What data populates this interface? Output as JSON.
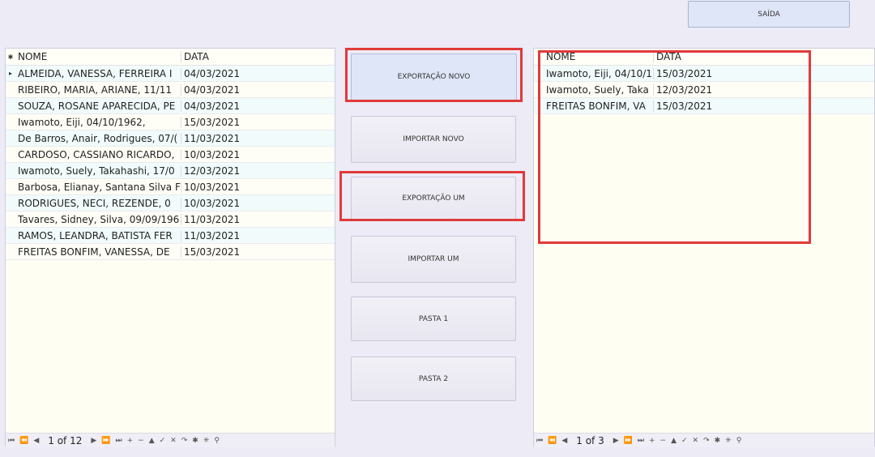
{
  "exit_button": "SAÍDA",
  "actions": {
    "export_new": "EXPORTAÇÃO NOVO",
    "import_new": "IMPORTAR NOVO",
    "export_one": "EXPORTAÇÃO UM",
    "import_one": "IMPORTAR UM",
    "folder1": "PASTA 1",
    "folder2": "PASTA 2"
  },
  "left_grid": {
    "header_indicator": "✱",
    "columns": [
      "NOME",
      "DATA"
    ],
    "rows": [
      [
        "ALMEIDA, VANESSA, FERREIRA I",
        "04/03/2021"
      ],
      [
        "RIBEIRO, MARIA, ARIANE, 11/11",
        "04/03/2021"
      ],
      [
        "SOUZA, ROSANE APARECIDA, PE",
        "04/03/2021"
      ],
      [
        "Iwamoto, Eiji, 04/10/1962,",
        "15/03/2021"
      ],
      [
        "De Barros, Anair, Rodrigues, 07/(",
        "11/03/2021"
      ],
      [
        "CARDOSO, CASSIANO RICARDO,",
        "10/03/2021"
      ],
      [
        "Iwamoto, Suely, Takahashi, 17/0",
        "12/03/2021"
      ],
      [
        "Barbosa, Elianay, Santana Silva F",
        "10/03/2021"
      ],
      [
        "RODRIGUES, NECI, REZENDE, 0",
        "10/03/2021"
      ],
      [
        "Tavares, Sidney, Silva, 09/09/196",
        "11/03/2021"
      ],
      [
        "RAMOS, LEANDRA, BATISTA FER",
        "11/03/2021"
      ],
      [
        "FREITAS BONFIM, VANESSA, DE",
        "15/03/2021"
      ]
    ],
    "current_row_indicator": "▸",
    "position": "1 of 12"
  },
  "right_grid": {
    "columns": [
      "NOME",
      "DATA"
    ],
    "rows": [
      [
        "Iwamoto, Eiji, 04/10/1",
        "15/03/2021"
      ],
      [
        "Iwamoto, Suely, Taka",
        "12/03/2021"
      ],
      [
        "FREITAS BONFIM, VA",
        "15/03/2021"
      ]
    ],
    "position": "1 of 3"
  },
  "nav_icons": [
    "⏮",
    "⏪",
    "◀",
    "▶",
    "⏩",
    "⏭",
    "+",
    "−",
    "▲",
    "✓",
    "✕",
    "↷",
    "✱",
    "✳",
    "⚲"
  ],
  "colors": {
    "highlight": "#e03a3a",
    "row_alt": "#f1fbfb",
    "grid_bg": "#fffef3"
  }
}
